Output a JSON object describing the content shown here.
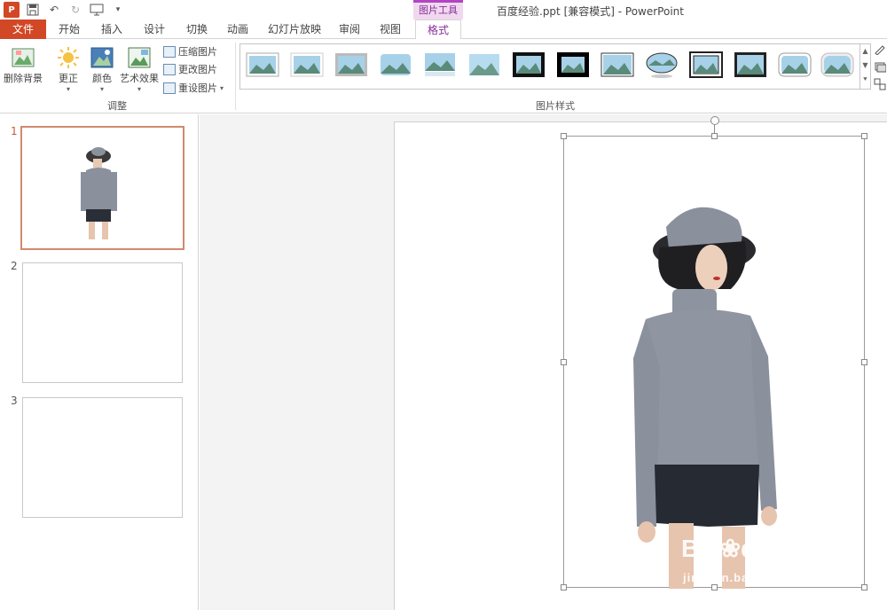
{
  "window": {
    "title": "百度经验.ppt [兼容模式] - PowerPoint",
    "contextual_group": "图片工具",
    "logo_text": "P"
  },
  "tabs": [
    {
      "label": "文件"
    },
    {
      "label": "开始"
    },
    {
      "label": "插入"
    },
    {
      "label": "设计"
    },
    {
      "label": "切换"
    },
    {
      "label": "动画"
    },
    {
      "label": "幻灯片放映"
    },
    {
      "label": "审阅"
    },
    {
      "label": "视图"
    },
    {
      "label": "格式"
    }
  ],
  "ribbon": {
    "remove_bg": "删除背景",
    "corrections": "更正",
    "color": "颜色",
    "artistic": "艺术效果",
    "compress": "压缩图片",
    "change": "更改图片",
    "reset": "重设图片",
    "group_adjust": "调整",
    "group_styles": "图片样式"
  },
  "slides": [
    {
      "number": "1"
    },
    {
      "number": "2"
    },
    {
      "number": "3"
    }
  ],
  "watermark": {
    "brand": "Bai",
    "brand2": "du",
    "brand_cn": "经验",
    "url": "jingyan.baidu.com"
  },
  "colors": {
    "accent": "#d24726",
    "contextual": "#b146c2",
    "selection": "#d08a6e"
  }
}
